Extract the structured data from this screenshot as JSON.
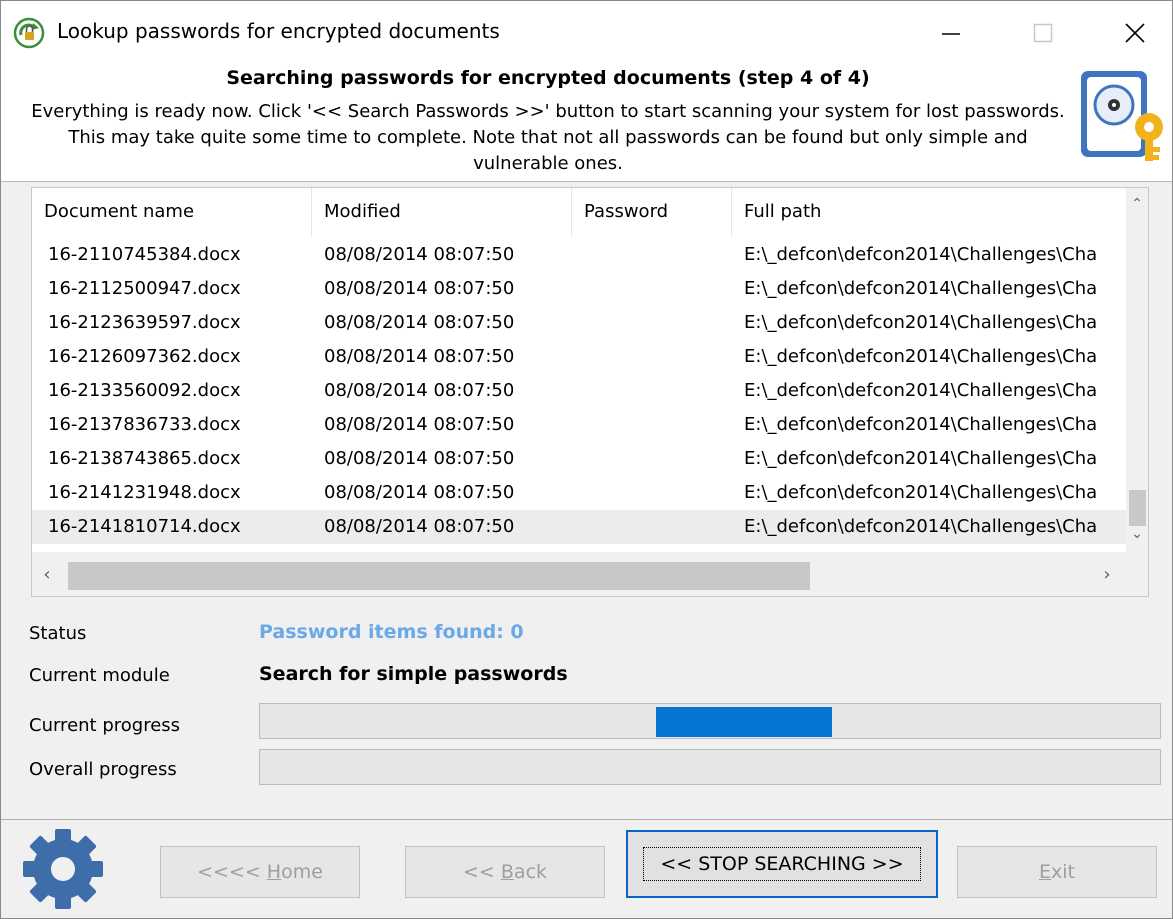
{
  "window": {
    "title": "Lookup passwords for encrypted documents"
  },
  "header": {
    "title": "Searching passwords for encrypted documents (step 4 of 4)",
    "description": "Everything is ready now. Click '<< Search Passwords >>' button to start scanning your system for lost passwords. This may take quite some time to complete. Note that not all passwords can be found but only simple and vulnerable ones.",
    "icon": "drive-key-icon"
  },
  "table": {
    "columns": [
      "Document name",
      "Modified",
      "Password",
      "Full path"
    ],
    "rows": [
      {
        "name": "16-2110745384.docx",
        "modified": "08/08/2014 08:07:50",
        "password": "",
        "path": "E:\\_defcon\\defcon2014\\Challenges\\Cha"
      },
      {
        "name": "16-2112500947.docx",
        "modified": "08/08/2014 08:07:50",
        "password": "",
        "path": "E:\\_defcon\\defcon2014\\Challenges\\Cha"
      },
      {
        "name": "16-2123639597.docx",
        "modified": "08/08/2014 08:07:50",
        "password": "",
        "path": "E:\\_defcon\\defcon2014\\Challenges\\Cha"
      },
      {
        "name": "16-2126097362.docx",
        "modified": "08/08/2014 08:07:50",
        "password": "",
        "path": "E:\\_defcon\\defcon2014\\Challenges\\Cha"
      },
      {
        "name": "16-2133560092.docx",
        "modified": "08/08/2014 08:07:50",
        "password": "",
        "path": "E:\\_defcon\\defcon2014\\Challenges\\Cha"
      },
      {
        "name": "16-2137836733.docx",
        "modified": "08/08/2014 08:07:50",
        "password": "",
        "path": "E:\\_defcon\\defcon2014\\Challenges\\Cha"
      },
      {
        "name": "16-2138743865.docx",
        "modified": "08/08/2014 08:07:50",
        "password": "",
        "path": "E:\\_defcon\\defcon2014\\Challenges\\Cha"
      },
      {
        "name": "16-2141231948.docx",
        "modified": "08/08/2014 08:07:50",
        "password": "",
        "path": "E:\\_defcon\\defcon2014\\Challenges\\Cha"
      },
      {
        "name": "16-2141810714.docx",
        "modified": "08/08/2014 08:07:50",
        "password": "",
        "path": "E:\\_defcon\\defcon2014\\Challenges\\Cha"
      }
    ],
    "selected_row": 8
  },
  "status": {
    "status_label": "Status",
    "status_value": "Password items found:  0",
    "module_label": "Current module",
    "module_value": "Search for simple passwords",
    "current_progress_label": "Current progress",
    "overall_progress_label": "Overall progress",
    "current_progress_fill": {
      "start": 0.44,
      "end": 0.635
    },
    "overall_progress_fill": 0
  },
  "buttons": {
    "home_label_prefix": "<<<< ",
    "home_label_key": "H",
    "home_label_rest": "ome",
    "back_label_prefix": "<< ",
    "back_label_key": "B",
    "back_label_rest": "ack",
    "stop_label": "<< STOP SEARCHING >>",
    "exit_label_key": "E",
    "exit_label_rest": "xit"
  },
  "colors": {
    "accent": "#0676d4",
    "status_text": "#6aa8e8",
    "focus_border": "#0a64c8"
  }
}
